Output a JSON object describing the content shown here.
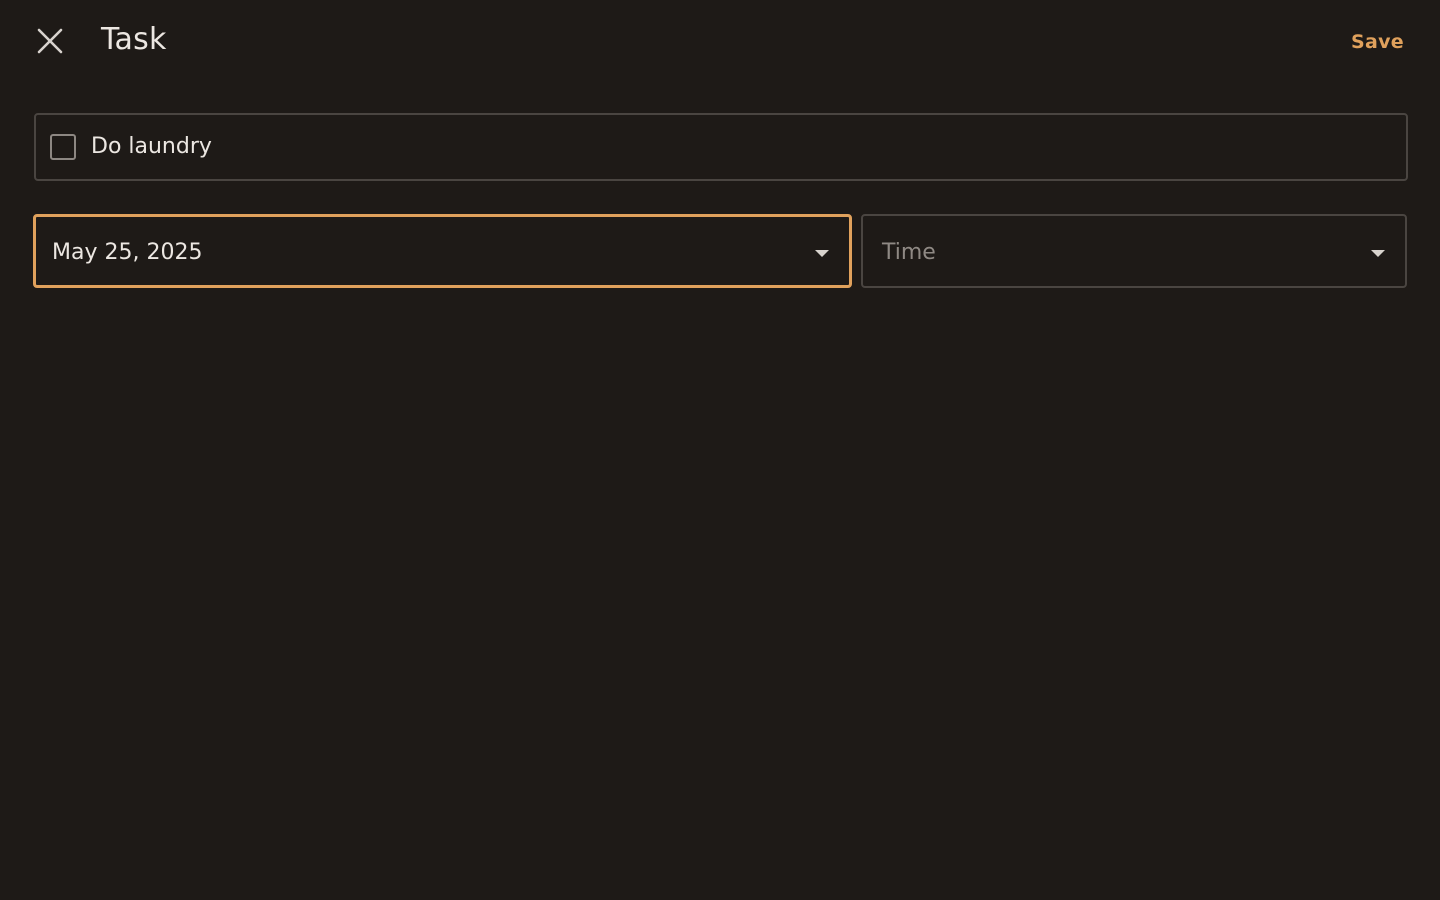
{
  "header": {
    "title": "Task",
    "save_label": "Save",
    "close_icon": "close-icon"
  },
  "task": {
    "name": "Do laundry",
    "completed": false
  },
  "date_select": {
    "value": "May 25, 2025"
  },
  "time_select": {
    "placeholder": "Time"
  },
  "colors": {
    "background": "#1e1a17",
    "accent": "#e0a15c",
    "text": "#ece7e2",
    "border": "#4a4541"
  }
}
